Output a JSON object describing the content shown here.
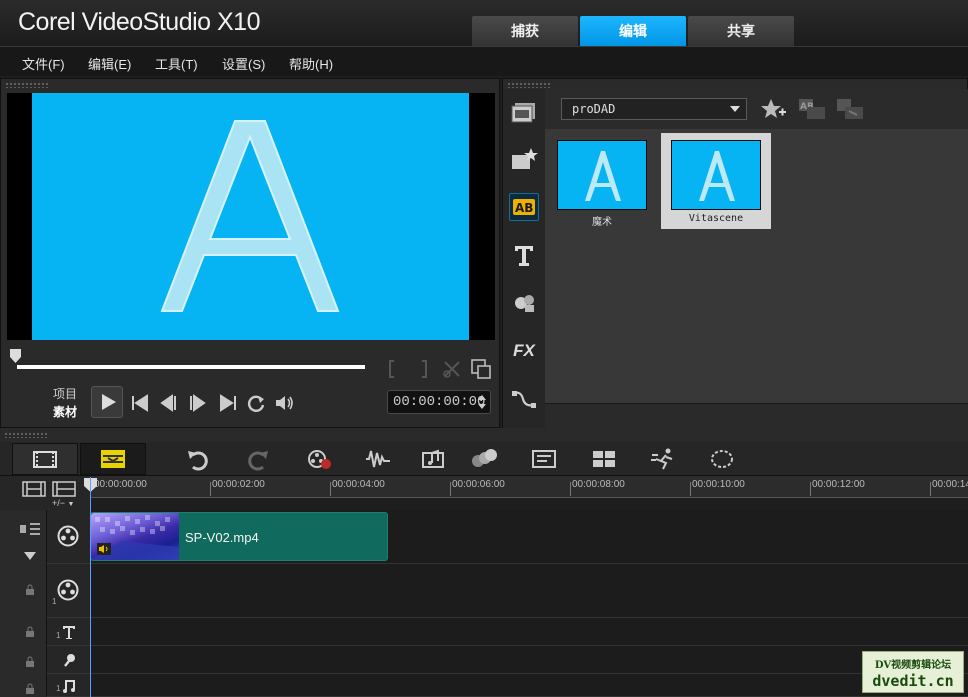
{
  "app": {
    "title": "Corel VideoStudio X10"
  },
  "top_tabs": [
    {
      "label": "捕获",
      "active": false
    },
    {
      "label": "编辑",
      "active": true
    },
    {
      "label": "共享",
      "active": false
    }
  ],
  "menu": [
    "文件(F)",
    "编辑(E)",
    "工具(T)",
    "设置(S)",
    "帮助(H)"
  ],
  "player": {
    "preview_glyph": "A",
    "mode_labels": [
      "项目",
      "素材"
    ],
    "timecode": "00:00:00:00",
    "colors": {
      "canvas": "#06b4f4",
      "glyph": "#a9e3f4"
    }
  },
  "library": {
    "dropdown_value": "proDAD",
    "sidebar_icons": [
      "media-icon",
      "instant-project-icon",
      "transition-icon",
      "title-icon",
      "graphic-icon",
      "fx-filter-icon",
      "path-icon"
    ],
    "sidebar_active": "transition-icon",
    "fx_label": "FX",
    "items": [
      {
        "label": "魔术",
        "glyph": "A",
        "selected": false
      },
      {
        "label": "Vitascene",
        "glyph": "A",
        "selected": true
      }
    ]
  },
  "timeline": {
    "ruler_ticks": [
      "00:00:00:00",
      "00:00:02:00",
      "00:00:04:00",
      "00:00:06:00",
      "00:00:08:00",
      "00:00:10:00",
      "00:00:12:00",
      "00:00:14"
    ],
    "zoom_label": "+/−",
    "clip": {
      "name": "SP-V02.mp4"
    },
    "track_numbers": [
      "1",
      "1",
      "1"
    ]
  },
  "watermark": {
    "line1": "DV视频剪辑论坛",
    "line2": "dvedit.cn"
  },
  "colors": {
    "accent": "#0096e6",
    "clip": "#106a5e"
  }
}
